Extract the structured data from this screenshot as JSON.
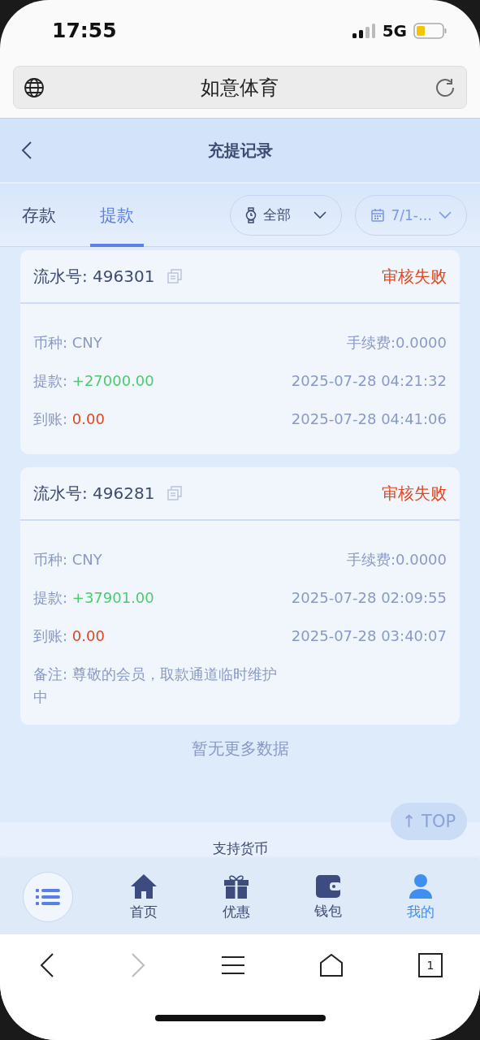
{
  "status_bar": {
    "time": "17:55",
    "network": "5G"
  },
  "browser": {
    "title": "如意体育",
    "tab_count": "1"
  },
  "header": {
    "title": "充提记录"
  },
  "tabs": [
    {
      "label": "存款",
      "selected": false
    },
    {
      "label": "提款",
      "selected": true
    }
  ],
  "filters": [
    {
      "kind": "status",
      "label": "全部"
    },
    {
      "kind": "date",
      "label": "7/1-…"
    }
  ],
  "records": [
    {
      "serial_label": "流水号: ",
      "serial": "496301",
      "status": "审核失败",
      "currency_label": "币种: ",
      "currency": "CNY",
      "fee": "手续费:0.0000",
      "amount_label": "提款: ",
      "amount": "+27000.00",
      "created": "2025-07-28 04:21:32",
      "received_label": "到账: ",
      "received": "0.00",
      "completed": "2025-07-28 04:41:06"
    },
    {
      "serial_label": "流水号: ",
      "serial": "496281",
      "status": "审核失败",
      "currency_label": "币种: ",
      "currency": "CNY",
      "fee": "手续费:0.0000",
      "amount_label": "提款: ",
      "amount": "+37901.00",
      "created": "2025-07-28 02:09:55",
      "received_label": "到账: ",
      "received": "0.00",
      "completed": "2025-07-28 03:40:07",
      "note": "备注: 尊敬的会员，取款通道临时维护中"
    }
  ],
  "end_text": "暂无更多数据",
  "top_button": "↑ TOP",
  "footer_text": "支持货币",
  "nav": [
    {
      "kind": "home",
      "label": "首页",
      "selected": false
    },
    {
      "kind": "gift",
      "label": "优惠",
      "selected": false
    },
    {
      "kind": "wallet",
      "label": "钱包",
      "selected": false
    },
    {
      "kind": "user",
      "label": "我的",
      "selected": true
    }
  ]
}
